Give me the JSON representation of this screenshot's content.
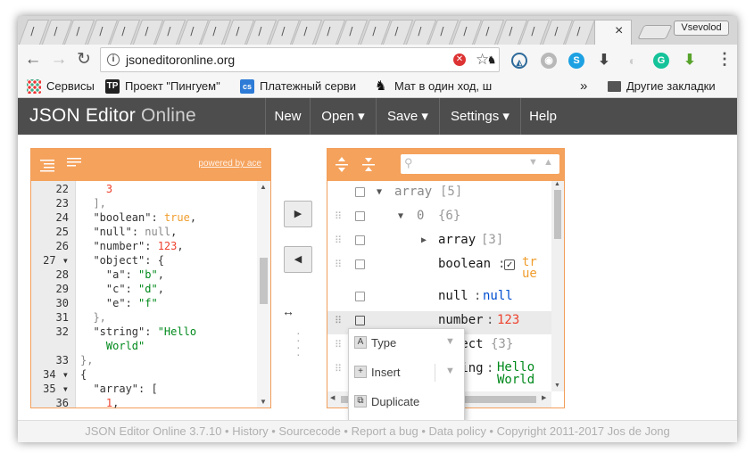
{
  "browser": {
    "tab_letters": [
      "/",
      "/",
      "/",
      "/",
      "/",
      "/",
      "/",
      "/",
      "/",
      "/",
      "/",
      "/",
      "/",
      "/",
      "/",
      "/",
      "/",
      "/",
      "/",
      "/",
      "/",
      "/",
      "/",
      "/",
      "/"
    ],
    "active_tab_close": "×",
    "profile_name": "Vsevolod",
    "url": "jsoneditoronline.org",
    "bookmarks": [
      {
        "label": "Сервисы",
        "icon": "apps-grid-icon"
      },
      {
        "label": "Проект \"Пингуем\"",
        "icon": "tp-logo-icon"
      },
      {
        "label": "Платежный серви",
        "icon": "payment-icon"
      },
      {
        "label": "Мат в один ход, ш",
        "icon": "chess-knight-icon"
      }
    ],
    "bookmarks_more": "»",
    "other_bookmarks": "Другие закладки"
  },
  "app": {
    "logo_main": "JSON Editor",
    "logo_light": " Online",
    "menu": [
      "New",
      "Open ▾",
      "Save ▾",
      "Settings ▾",
      "Help"
    ],
    "powered_by": "powered by ace"
  },
  "code_editor": {
    "line_numbers": [
      "22",
      "23",
      "24",
      "25",
      "26",
      "27 ▾",
      "28",
      "29",
      "30",
      "31",
      "32",
      "",
      "33",
      "34 ▾",
      "35 ▾",
      "36"
    ]
  },
  "tree": {
    "rows": [
      {
        "field": "array",
        "meta": "[5]"
      },
      {
        "field": "0",
        "meta": "{6}"
      },
      {
        "field": "array",
        "meta": "[3]"
      },
      {
        "field": "boolean",
        "value": "true"
      },
      {
        "field": "null",
        "value": "null"
      },
      {
        "field": "number",
        "value": "123"
      },
      {
        "field": "object",
        "meta": "{3}"
      },
      {
        "field": "string",
        "value": "Hello World"
      }
    ]
  },
  "context_menu": {
    "items": [
      "Type",
      "Insert",
      "Duplicate"
    ]
  },
  "footer": "JSON Editor Online 3.7.10 • History • Sourcecode • Report a bug • Data policy • Copyright 2011-2017 Jos de Jong"
}
